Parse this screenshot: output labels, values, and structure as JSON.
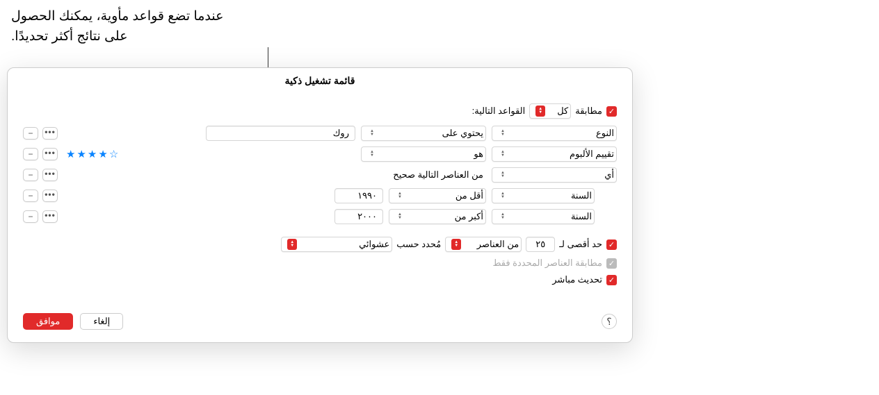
{
  "callout": "عندما تضع قواعد مأوية، يمكنك الحصول على نتائج أكثر تحديدًا.",
  "dialog": {
    "title": "قائمة تشغيل ذكية",
    "match": {
      "label": "مطابقة",
      "mode": "كل",
      "suffix": "القواعد التالية:"
    },
    "rules": [
      {
        "field": "النوع",
        "op": "يحتوي على",
        "value": "روك",
        "type": "text",
        "indent": false
      },
      {
        "field": "تقييم الألبوم",
        "op": "هو",
        "stars_filled": 4,
        "stars_total": 5,
        "type": "stars",
        "indent": false
      },
      {
        "field": "أي",
        "suffix": "من العناصر التالية صحيح",
        "type": "group",
        "indent": false
      },
      {
        "field": "السنة",
        "op": "أقل من",
        "value": "١٩٩٠",
        "type": "num",
        "indent": true
      },
      {
        "field": "السنة",
        "op": "أكبر من",
        "value": "٢٠٠٠",
        "type": "num",
        "indent": true
      }
    ],
    "limit": {
      "label": "حد أقصى لـ",
      "value": "٢٥",
      "unit": "من العناصر",
      "selected_label": "مُحدد حسب",
      "selection": "عشوائي"
    },
    "match_checked": "مطابقة العناصر المحددة فقط",
    "live_update": "تحديث مباشر",
    "buttons": {
      "help": "؟",
      "cancel": "إلغاء",
      "ok": "موافق"
    }
  }
}
